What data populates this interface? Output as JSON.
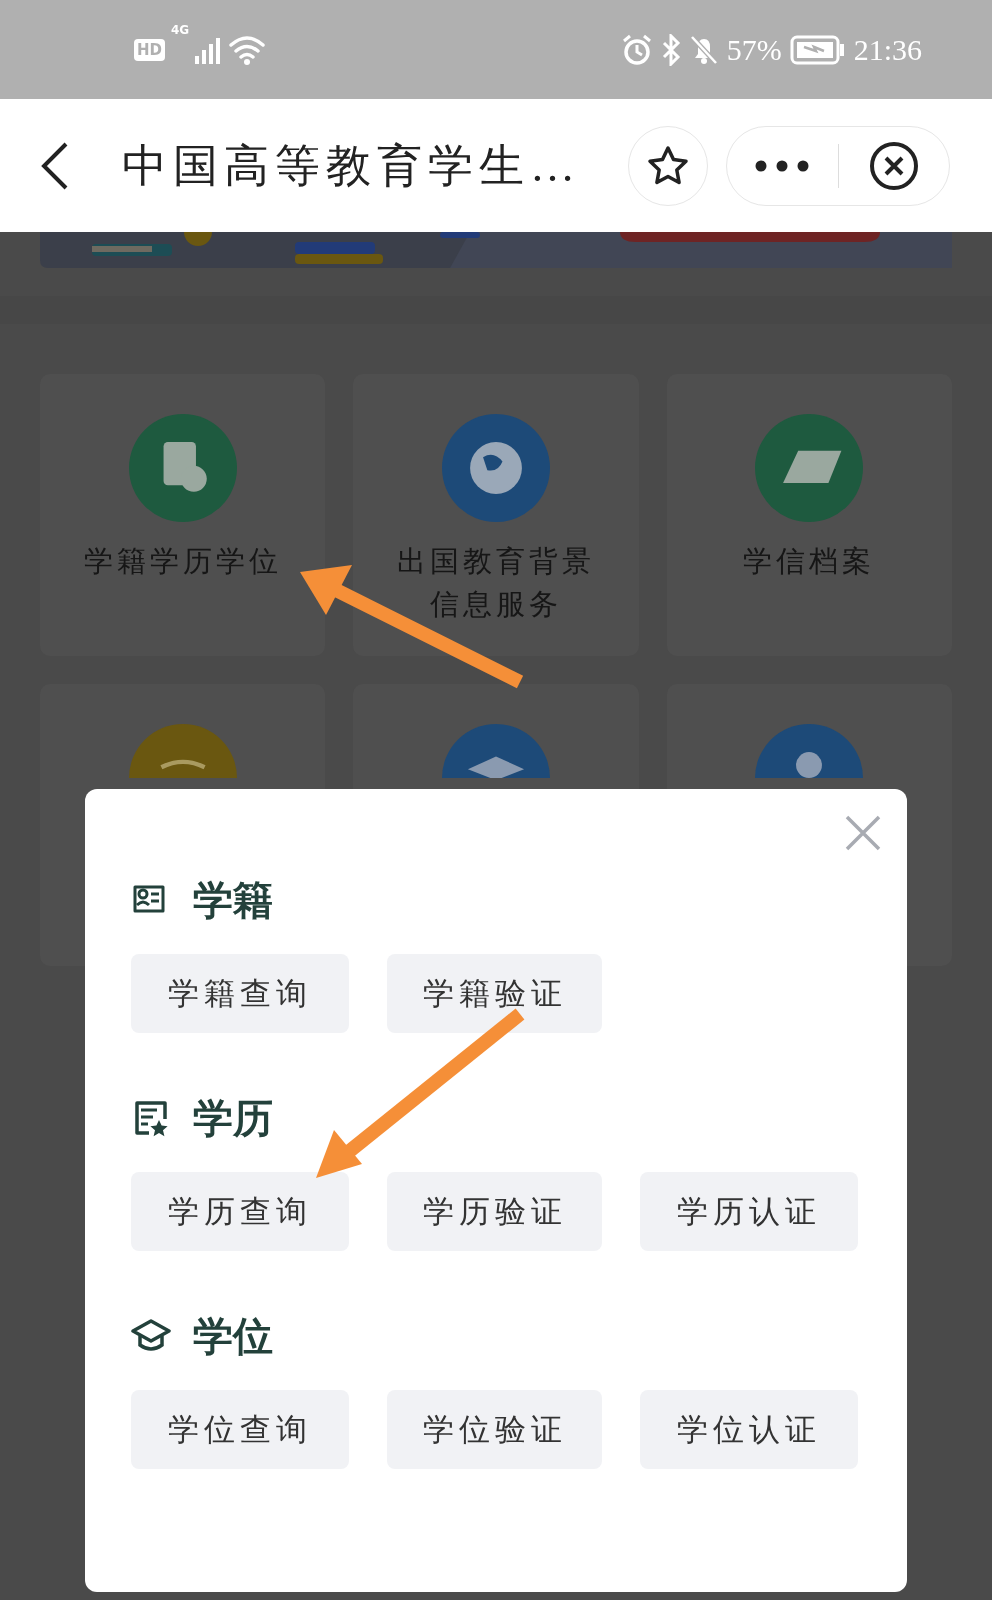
{
  "status_bar": {
    "hd": "HD",
    "network": "4G",
    "battery": "57%",
    "time": "21:36"
  },
  "nav": {
    "title": "中国高等教育学生…"
  },
  "cards": [
    {
      "label": "学籍学历学位",
      "color": "#1e5a3f"
    },
    {
      "label": "出国教育背景信息服务",
      "color": "#1d4a78"
    },
    {
      "label": "学信档案",
      "color": "#1e5a3f"
    },
    {
      "color": "#6a5710"
    },
    {
      "color": "#1d4a78"
    },
    {
      "color": "#1d4a78"
    }
  ],
  "modal": {
    "sections": [
      {
        "title": "学籍",
        "buttons": [
          "学籍查询",
          "学籍验证"
        ]
      },
      {
        "title": "学历",
        "buttons": [
          "学历查询",
          "学历验证",
          "学历认证"
        ]
      },
      {
        "title": "学位",
        "buttons": [
          "学位查询",
          "学位验证",
          "学位认证"
        ]
      }
    ]
  }
}
